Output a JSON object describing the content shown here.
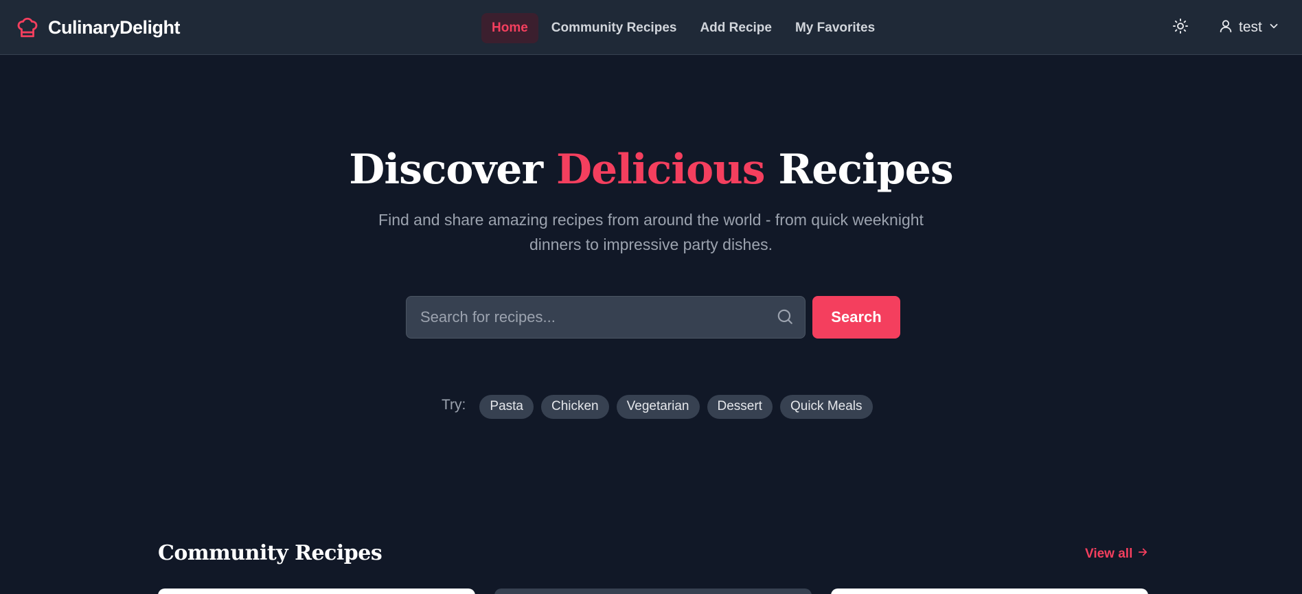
{
  "brand": {
    "name": "CulinaryDelight",
    "icon": "chef-hat-icon"
  },
  "nav": {
    "items": [
      {
        "label": "Home",
        "active": true
      },
      {
        "label": "Community Recipes",
        "active": false
      },
      {
        "label": "Add Recipe",
        "active": false
      },
      {
        "label": "My Favorites",
        "active": false
      }
    ]
  },
  "header": {
    "theme_icon": "sun-icon",
    "user": {
      "name": "test",
      "icon": "user-icon",
      "chevron": "chevron-down-icon"
    }
  },
  "hero": {
    "title_before": "Discover",
    "title_accent": "Delicious",
    "title_after": "Recipes",
    "subtitle": "Find and share amazing recipes from around the world - from quick weeknight dinners to impressive party dishes."
  },
  "search": {
    "placeholder": "Search for recipes...",
    "value": "",
    "button_label": "Search"
  },
  "try": {
    "label": "Try:",
    "tags": [
      "Pasta",
      "Chicken",
      "Vegetarian",
      "Dessert",
      "Quick Meals"
    ]
  },
  "community": {
    "title": "Community Recipes",
    "view_all": "View all"
  },
  "colors": {
    "accent": "#f43f5e",
    "background": "#111827",
    "navbar": "#1f2937",
    "chip": "#374151"
  }
}
